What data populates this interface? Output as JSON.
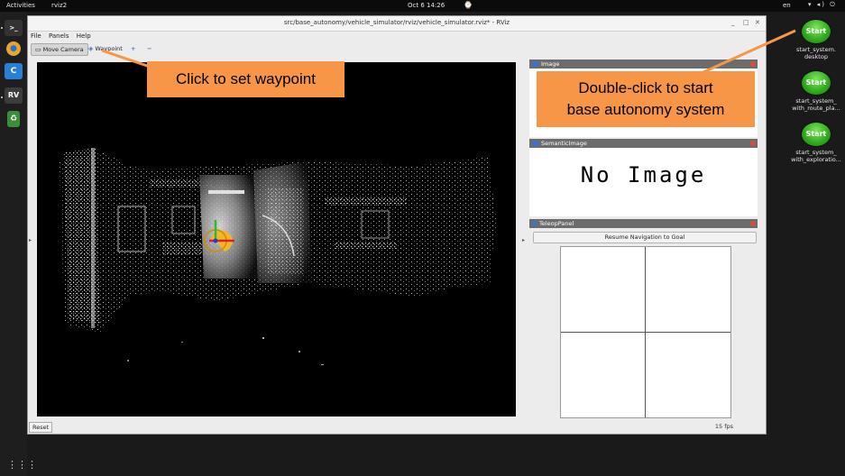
{
  "topbar": {
    "activities": "Activities",
    "app_name": "rviz2",
    "clock": "Oct 6  14:26",
    "language": "en",
    "tray": "▾ ◂) ⏻"
  },
  "dock": {
    "items": [
      {
        "icon": "terminal-icon",
        "glyph": ">_"
      },
      {
        "icon": "chrome-icon",
        "glyph": "●"
      },
      {
        "icon": "visual-studio-code-icon",
        "glyph": "C"
      },
      {
        "icon": "rviz-icon",
        "glyph": "RV"
      },
      {
        "icon": "trash-icon",
        "glyph": "♻"
      }
    ],
    "apps_grid_glyph": "⋮⋮⋮"
  },
  "desktop": {
    "icons": [
      {
        "glyph": "Start",
        "label_line1": "start_system.",
        "label_line2": "desktop"
      },
      {
        "glyph": "Start",
        "label_line1": "start_system_",
        "label_line2": "with_route_pla..."
      },
      {
        "glyph": "Start",
        "label_line1": "start_system_",
        "label_line2": "with_exploratio..."
      }
    ]
  },
  "window": {
    "title": "src/base_autonomy/vehicle_simulator/rviz/vehicle_simulator.rviz* - RViz",
    "minimize": "_",
    "maximize": "□",
    "close": "✕",
    "menu": [
      "File",
      "Panels",
      "Help"
    ],
    "toolbar": {
      "move_camera": "Move Camera",
      "waypoint": "Waypoint",
      "add": "+",
      "remove": "−"
    },
    "panels": {
      "image": {
        "title": "Image"
      },
      "semantic": {
        "title": "SemanticImage",
        "placeholder": "No Image"
      },
      "teleop": {
        "title": "TeleopPanel",
        "resume_button": "Resume Navigation to Goal"
      }
    },
    "status": {
      "reset": "Reset",
      "fps": "15 fps"
    }
  },
  "callouts": {
    "waypoint": "Click to set waypoint",
    "start_line1": "Double-click to start",
    "start_line2": "base autonomy system"
  },
  "colors": {
    "callout": "#f79646",
    "panel_header": "#6c6c6c",
    "close_dot": "#e04a3c",
    "start_icon": "#2fa61c"
  }
}
